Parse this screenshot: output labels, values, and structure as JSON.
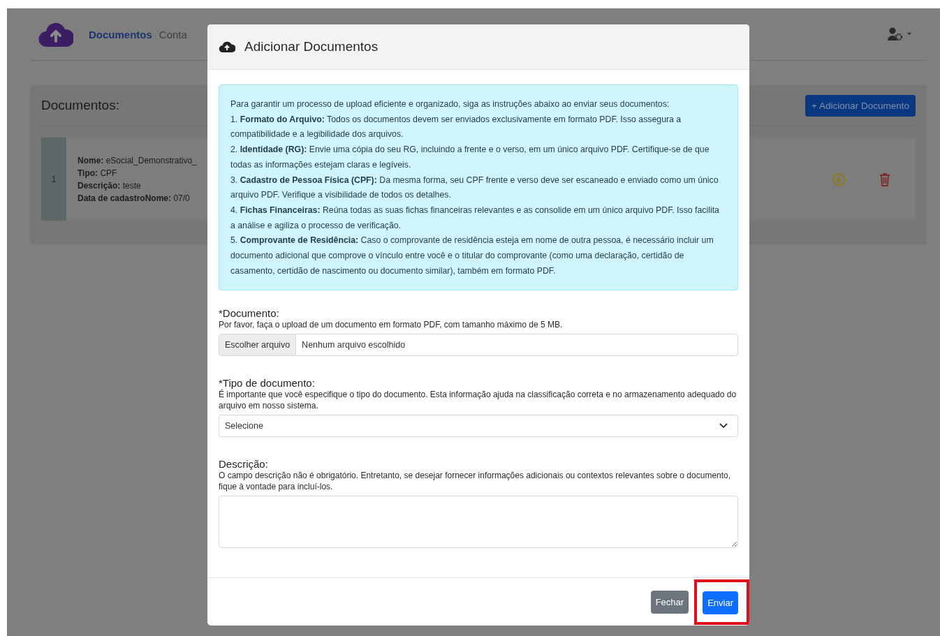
{
  "nav": {
    "links": [
      {
        "label": "Documentos",
        "selected": true
      },
      {
        "label": "Conta",
        "selected": false
      }
    ]
  },
  "page": {
    "title": "Documentos:",
    "add_button": "+ Adicionar Documento",
    "documents": [
      {
        "index": "1",
        "fields": [
          {
            "label": "Nome:",
            "value": "eSocial_Demonstrativo_"
          },
          {
            "label": "Tipo:",
            "value": "CPF"
          },
          {
            "label": "Descrição:",
            "value": "teste"
          },
          {
            "label": "Data de cadastroNome:",
            "value": "07/0"
          }
        ]
      }
    ]
  },
  "modal": {
    "title": "Adicionar Documentos",
    "instructions": [
      "Para garantir um processo de upload eficiente e organizado, siga as instruções abaixo ao enviar seus documentos:",
      "1. **Formato do Arquivo:** Todos os documentos devem ser enviados exclusivamente em formato PDF. Isso assegura a compatibilidade e a legibilidade dos arquivos.",
      "2. **Identidade (RG):** Envie uma cópia do seu RG, incluindo a frente e o verso, em um único arquivo PDF. Certifique-se de que todas as informações estejam claras e legíveis.",
      "3. **Cadastro de Pessoa Física (CPF):** Da mesma forma, seu CPF frente e verso deve ser escaneado e enviado como um único arquivo PDF. Verifique a visibilidade de todos os detalhes.",
      "4. **Fichas Financeiras:** Reúna todas as suas fichas financeiras relevantes e as consolide em um único arquivo PDF. Isso facilita a análise e agiliza o processo de verificação.",
      "5. **Comprovante de Residência:** Caso o comprovante de residência esteja em nome de outra pessoa, é necessário incluir um documento adicional que comprove o vínculo entre você e o titular do comprovante (como uma declaração, certidão de casamento, certidão de nascimento ou documento similar), também em formato PDF."
    ],
    "fields": [
      {
        "kind": "file",
        "label": "*Documento:",
        "help": "Por favor, faça o upload de um documento em formato PDF, com tamanho máximo de 5 MB.",
        "button": "Escolher arquivo",
        "status": "Nenhum arquivo escolhido"
      },
      {
        "kind": "select",
        "label": "*Tipo de documento:",
        "help": "É importante que você especifique o tipo do documento. Esta informação ajuda na classificação correta e no armazenamento adequado do arquivo em nosso sistema.",
        "value": "Selecione"
      },
      {
        "kind": "textarea",
        "label": "Descrição:",
        "help": "O campo descrição não é obrigatório. Entretanto, se desejar fornecer informações adicionais ou contextos relevantes sobre o documento, fique à vontade para incluí-los."
      }
    ],
    "buttons": [
      {
        "label": "Fechar",
        "kind": "secondary",
        "highlighted": false
      },
      {
        "label": "Enviar",
        "kind": "primary",
        "highlighted": true
      }
    ]
  }
}
